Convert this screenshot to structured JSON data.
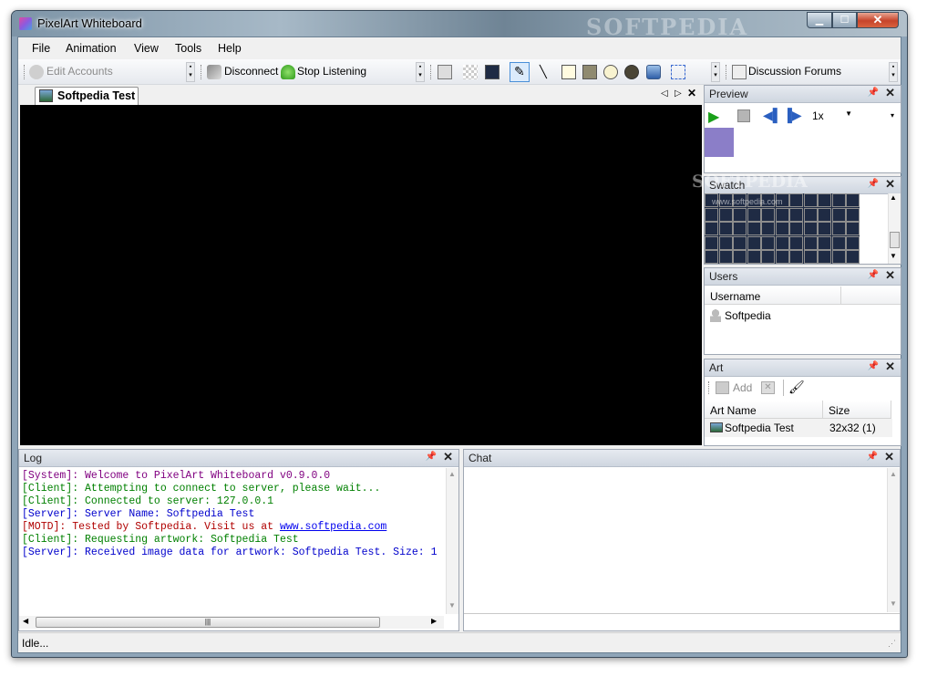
{
  "window": {
    "title": "PixelArt Whiteboard",
    "watermark": "SOFTPEDIA",
    "min": "▁",
    "max": "☐",
    "close": "✕"
  },
  "menu": [
    "File",
    "Animation",
    "View",
    "Tools",
    "Help"
  ],
  "toolbar": {
    "edit_accounts": "Edit Accounts",
    "disconnect": "Disconnect",
    "stop_listening": "Stop Listening",
    "discussion_forums": "Discussion Forums"
  },
  "document": {
    "tab_label": "Softpedia Test"
  },
  "preview": {
    "title": "Preview",
    "speed": "1x",
    "preview_color": "#8b7ec8"
  },
  "swatch": {
    "title": "Swatch",
    "watermark": "SOFTPEDIA",
    "watermark_url": "www.softpedia.com"
  },
  "users": {
    "title": "Users",
    "col_username": "Username",
    "rows": [
      {
        "name": "Softpedia"
      }
    ]
  },
  "art": {
    "title": "Art",
    "add": "Add",
    "col_name": "Art Name",
    "col_size": "Size",
    "rows": [
      {
        "name": "Softpedia Test",
        "size": "32x32 (1)"
      }
    ]
  },
  "log": {
    "title": "Log",
    "lines": [
      {
        "text": "[System]: Welcome to PixelArt Whiteboard v0.9.0.0",
        "color": "#800080"
      },
      {
        "text": "[Client]: Attempting to connect to server, please wait...",
        "color": "#008000"
      },
      {
        "text": "[Client]: Connected to server: 127.0.0.1",
        "color": "#008000"
      },
      {
        "text": "[Server]: Server Name: Softpedia Test",
        "color": "#0000cc"
      },
      {
        "prefix": "[MOTD]: Tested by Softpedia. Visit us at ",
        "link": "www.softpedia.com",
        "color": "#b00000"
      },
      {
        "text": "[Client]: Requesting artwork: Softpedia Test",
        "color": "#008000"
      },
      {
        "text": "[Server]: Received image data for artwork: Softpedia Test. Size: 1",
        "color": "#0000cc"
      }
    ]
  },
  "chat": {
    "title": "Chat"
  },
  "status": {
    "text": "Idle..."
  }
}
